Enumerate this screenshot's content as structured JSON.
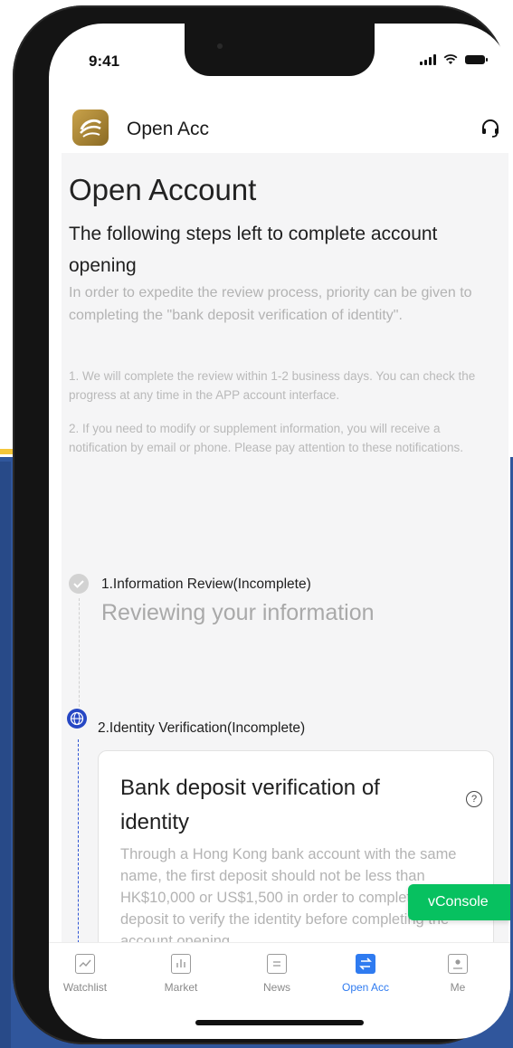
{
  "status_bar": {
    "time": "9:41"
  },
  "header": {
    "title": "Open Acc"
  },
  "page": {
    "title": "Open Account",
    "subtitle": "The following steps left to complete account opening",
    "intro": "In order to expedite the review process, priority can be given to completing the \"bank deposit verification of identity\".",
    "notes": [
      "1. We will complete the review within 1-2 business days. You can check the progress at any time in the APP account interface.",
      "2. If you need to modify or supplement information, you will receive a notification by email or phone. Please pay attention to these notifications."
    ]
  },
  "steps": [
    {
      "title": "1.Information Review(Incomplete)",
      "subtitle": "Reviewing your information"
    },
    {
      "title": "2.Identity Verification(Incomplete)"
    }
  ],
  "card": {
    "title": "Bank deposit verification of identity",
    "help": "?",
    "body": "Through a Hong Kong bank account with the same name, the first deposit should not be less than HK$10,000 or US$1,500 in order to complete the deposit to verify the identity before completing the account opening"
  },
  "vconsole": {
    "label": "vConsole"
  },
  "tabbar": {
    "active": "Open Acc",
    "accent": "#2f7bf0",
    "items": [
      {
        "label": "Watchlist",
        "icon": "line-chart-icon"
      },
      {
        "label": "Market",
        "icon": "bar-chart-icon"
      },
      {
        "label": "News",
        "icon": "document-icon"
      },
      {
        "label": "Open Acc",
        "icon": "transfer-icon"
      },
      {
        "label": "Me",
        "icon": "person-icon"
      }
    ]
  }
}
